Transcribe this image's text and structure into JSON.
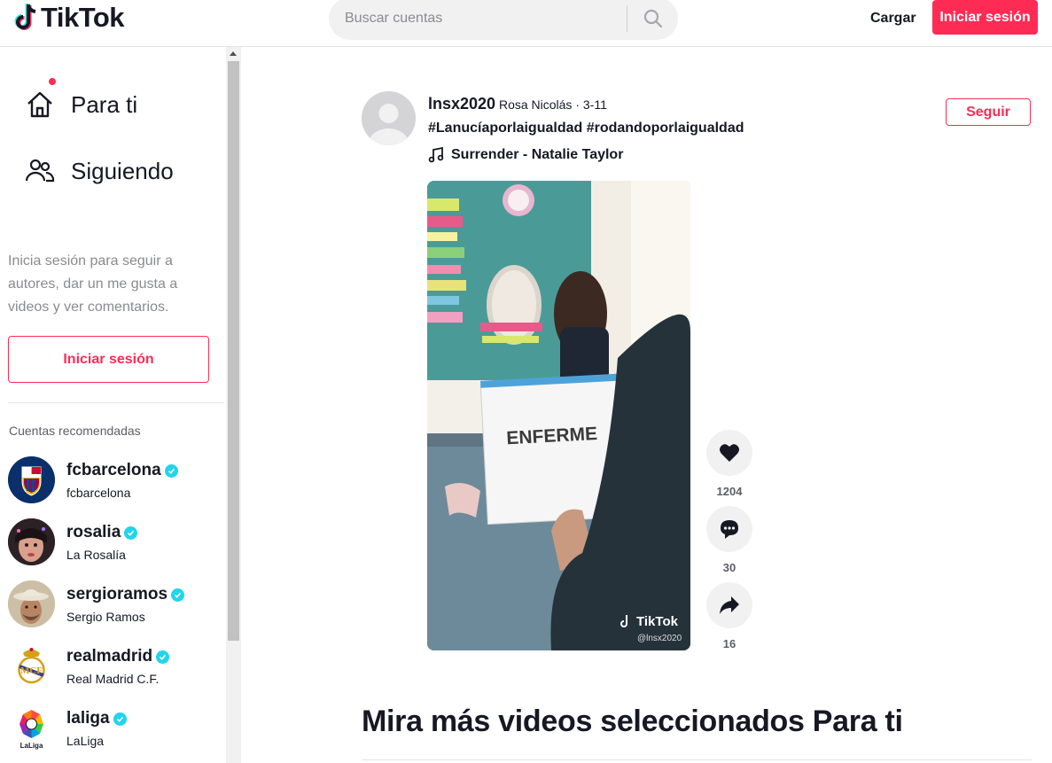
{
  "header": {
    "logo_text": "TikTok",
    "search_placeholder": "Buscar cuentas",
    "upload_label": "Cargar",
    "login_label": "Iniciar sesión",
    "accent_color": "#fe2c55"
  },
  "sidebar": {
    "nav": [
      {
        "label": "Para ti",
        "icon": "home-icon",
        "active": true
      },
      {
        "label": "Siguiendo",
        "icon": "users-icon"
      }
    ],
    "login_hint": "Inicia sesión para seguir a autores, dar un me gusta a videos y ver comentarios.",
    "login_label": "Iniciar sesión",
    "recommended_title": "Cuentas recomendadas",
    "accounts": [
      {
        "username": "fcbarcelona",
        "name": "fcbarcelona",
        "verified": true
      },
      {
        "username": "rosalia",
        "name": "La Rosalía",
        "verified": true
      },
      {
        "username": "sergioramos",
        "name": "Sergio Ramos",
        "verified": true
      },
      {
        "username": "realmadrid",
        "name": "Real Madrid C.F.",
        "verified": true
      },
      {
        "username": "laliga",
        "name": "LaLiga",
        "verified": true
      }
    ]
  },
  "post": {
    "username": "lnsx2020",
    "nickname": "Rosa Nicolás",
    "date": "3-11",
    "separator": " · ",
    "hashtags": "#Lanucíaporlaigualdad #rodandoporlaigualdad",
    "music": "Surrender - Natalie Taylor",
    "follow_label": "Seguir",
    "video_sign_text": "ENFERME",
    "watermark_brand": "TikTok",
    "watermark_user": "@lnsx2020",
    "likes": "1204",
    "comments": "30",
    "shares": "16"
  },
  "main": {
    "more_title": "Mira más videos seleccionados Para ti"
  }
}
